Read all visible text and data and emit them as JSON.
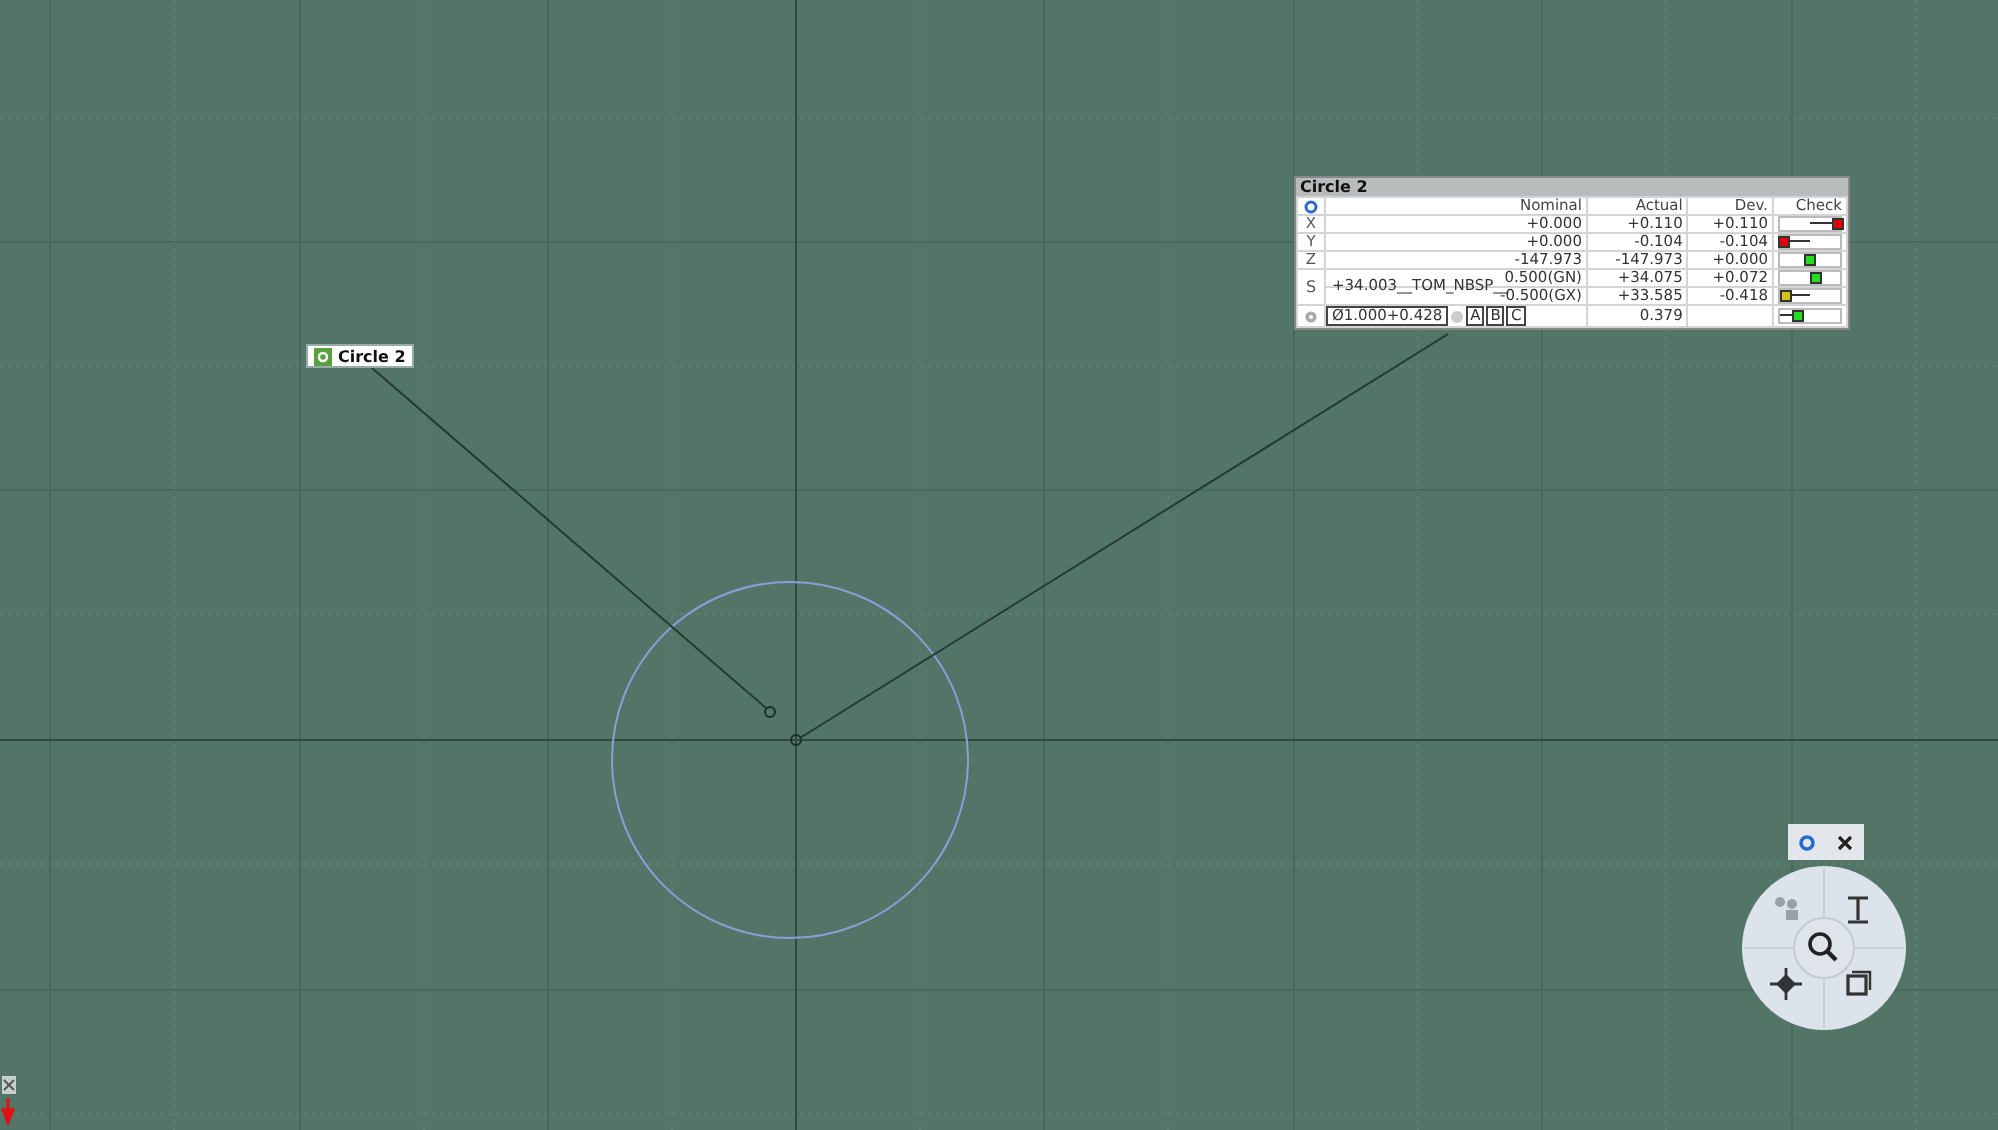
{
  "feature_label": {
    "title": "Circle 2"
  },
  "result_table": {
    "title": "Circle 2",
    "columns": [
      "Nominal",
      "Actual",
      "Dev.",
      "Check"
    ],
    "rows": [
      {
        "axis": "X",
        "nominal": "+0.000",
        "actual": "+0.110",
        "dev": "+0.110",
        "check": {
          "level": 0.95,
          "color": "#e00000"
        }
      },
      {
        "axis": "Y",
        "nominal": "+0.000",
        "actual": "-0.104",
        "dev": "-0.104",
        "check": {
          "level": 0.05,
          "color": "#e00000"
        }
      },
      {
        "axis": "Z",
        "nominal": "-147.973",
        "actual": "-147.973",
        "dev": "+0.000",
        "check": {
          "level": 0.5,
          "color": "#22dd22"
        }
      }
    ],
    "size_row": {
      "axis": "S",
      "value": "+34.003__TOM_NBSP__",
      "lines": [
        {
          "nominal": "0.500(GN)",
          "actual": "+34.075",
          "dev": "+0.072",
          "check": {
            "level": 0.6,
            "color": "#22dd22"
          }
        },
        {
          "nominal": "-0.500(GX)",
          "actual": "+33.585",
          "dev": "-0.418",
          "check": {
            "level": 0.1,
            "color": "#d4c21a"
          }
        }
      ]
    },
    "tolerance_row": {
      "tolerance": "Ø1.000+0.428",
      "datums": [
        "A",
        "B",
        "C"
      ],
      "actual": "0.379",
      "check": {
        "level": 0.3,
        "color": "#22dd22"
      }
    }
  }
}
